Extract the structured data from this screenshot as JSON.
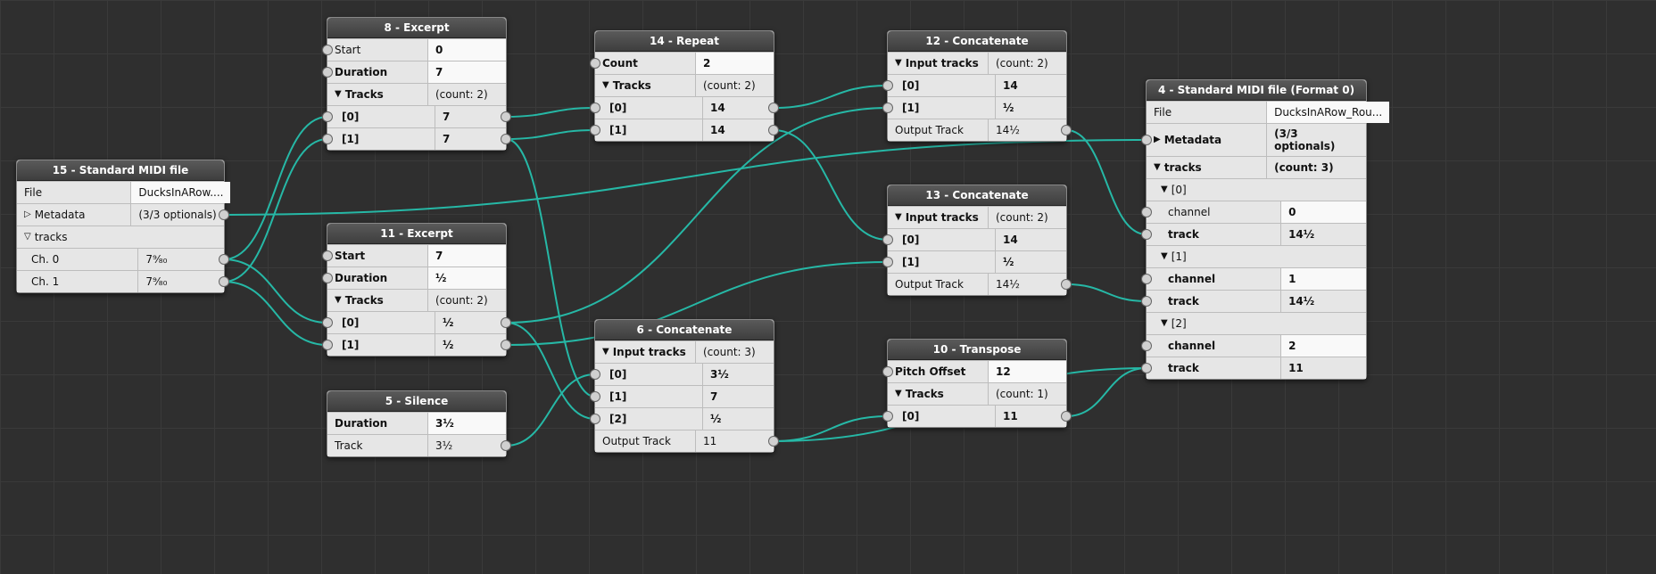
{
  "connection_color": "#26b8a6",
  "nodes": {
    "n15": {
      "title": "15 - Standard MIDI file",
      "rows": {
        "file_lbl": "File",
        "file_val": "DucksInARow....",
        "meta_lbl": "Metadata",
        "meta_val": "(3/3 optionals)",
        "tracks_lbl": "tracks",
        "ch0_lbl": "Ch. 0",
        "ch0_val": "7⁹⁄₈₀",
        "ch1_lbl": "Ch. 1",
        "ch1_val": "7⁹⁄₈₀"
      }
    },
    "n8": {
      "title": "8 - Excerpt",
      "rows": {
        "start_lbl": "Start",
        "start_val": "0",
        "dur_lbl": "Duration",
        "dur_val": "7",
        "tracks_lbl": "Tracks",
        "tracks_val": "(count: 2)",
        "t0_lbl": "[0]",
        "t0_val": "7",
        "t1_lbl": "[1]",
        "t1_val": "7"
      }
    },
    "n11": {
      "title": "11 - Excerpt",
      "rows": {
        "start_lbl": "Start",
        "start_val": "7",
        "dur_lbl": "Duration",
        "dur_val": "½",
        "tracks_lbl": "Tracks",
        "tracks_val": "(count: 2)",
        "t0_lbl": "[0]",
        "t0_val": "½",
        "t1_lbl": "[1]",
        "t1_val": "½"
      }
    },
    "n5": {
      "title": "5 - Silence",
      "rows": {
        "dur_lbl": "Duration",
        "dur_val": "3½",
        "trk_lbl": "Track",
        "trk_val": "3½"
      }
    },
    "n14": {
      "title": "14 - Repeat",
      "rows": {
        "cnt_lbl": "Count",
        "cnt_val": "2",
        "tracks_lbl": "Tracks",
        "tracks_val": "(count: 2)",
        "t0_lbl": "[0]",
        "t0_val": "14",
        "t1_lbl": "[1]",
        "t1_val": "14"
      }
    },
    "n6": {
      "title": "6 - Concatenate",
      "rows": {
        "in_lbl": "Input tracks",
        "in_val": "(count: 3)",
        "t0_lbl": "[0]",
        "t0_val": "3½",
        "t1_lbl": "[1]",
        "t1_val": "7",
        "t2_lbl": "[2]",
        "t2_val": "½",
        "out_lbl": "Output Track",
        "out_val": "11"
      }
    },
    "n12": {
      "title": "12 - Concatenate",
      "rows": {
        "in_lbl": "Input tracks",
        "in_val": "(count: 2)",
        "t0_lbl": "[0]",
        "t0_val": "14",
        "t1_lbl": "[1]",
        "t1_val": "½",
        "out_lbl": "Output Track",
        "out_val": "14½"
      }
    },
    "n13": {
      "title": "13 - Concatenate",
      "rows": {
        "in_lbl": "Input tracks",
        "in_val": "(count: 2)",
        "t0_lbl": "[0]",
        "t0_val": "14",
        "t1_lbl": "[1]",
        "t1_val": "½",
        "out_lbl": "Output Track",
        "out_val": "14½"
      }
    },
    "n10": {
      "title": "10 - Transpose",
      "rows": {
        "po_lbl": "Pitch Offset",
        "po_val": "12",
        "tracks_lbl": "Tracks",
        "tracks_val": "(count: 1)",
        "t0_lbl": "[0]",
        "t0_val": "11"
      }
    },
    "n4": {
      "title": "4 - Standard MIDI file (Format 0)",
      "rows": {
        "file_lbl": "File",
        "file_val": "DucksInARow_Rou...",
        "meta_lbl": "Metadata",
        "meta_val": "(3/3 optionals)",
        "tracks_lbl": "tracks",
        "tracks_val": "(count: 3)",
        "t0_lbl": "[0]",
        "t0_ch_lbl": "channel",
        "t0_ch_val": "0",
        "t0_trk_lbl": "track",
        "t0_trk_val": "14½",
        "t1_lbl": "[1]",
        "t1_ch_lbl": "channel",
        "t1_ch_val": "1",
        "t1_trk_lbl": "track",
        "t1_trk_val": "14½",
        "t2_lbl": "[2]",
        "t2_ch_lbl": "channel",
        "t2_ch_val": "2",
        "t2_trk_lbl": "track",
        "t2_trk_val": "11"
      }
    }
  },
  "connections": [
    [
      "n15.meta.out",
      "n4.meta.in"
    ],
    [
      "n15.ch0.out",
      "n8.t0.in"
    ],
    [
      "n15.ch1.out",
      "n8.t1.in"
    ],
    [
      "n15.ch0.out",
      "n11.t0.in"
    ],
    [
      "n15.ch1.out",
      "n11.t1.in"
    ],
    [
      "n8.t0.out",
      "n14.t0.in"
    ],
    [
      "n8.t1.out",
      "n14.t1.in"
    ],
    [
      "n8.t1.out",
      "n6.t1.in"
    ],
    [
      "n11.t0.out",
      "n12.t1.in"
    ],
    [
      "n11.t0.out",
      "n6.t2.in"
    ],
    [
      "n11.t1.out",
      "n13.t1.in"
    ],
    [
      "n5.trk.out",
      "n6.t0.in"
    ],
    [
      "n14.t0.out",
      "n12.t0.in"
    ],
    [
      "n14.t1.out",
      "n13.t0.in"
    ],
    [
      "n6.out.out",
      "n10.t0.in"
    ],
    [
      "n6.out.out",
      "n4.t2_trk.in"
    ],
    [
      "n12.out.out",
      "n4.t0_trk.in"
    ],
    [
      "n13.out.out",
      "n4.t1_trk.in"
    ],
    [
      "n10.t0.out",
      "n4.t2_trk.in"
    ]
  ]
}
